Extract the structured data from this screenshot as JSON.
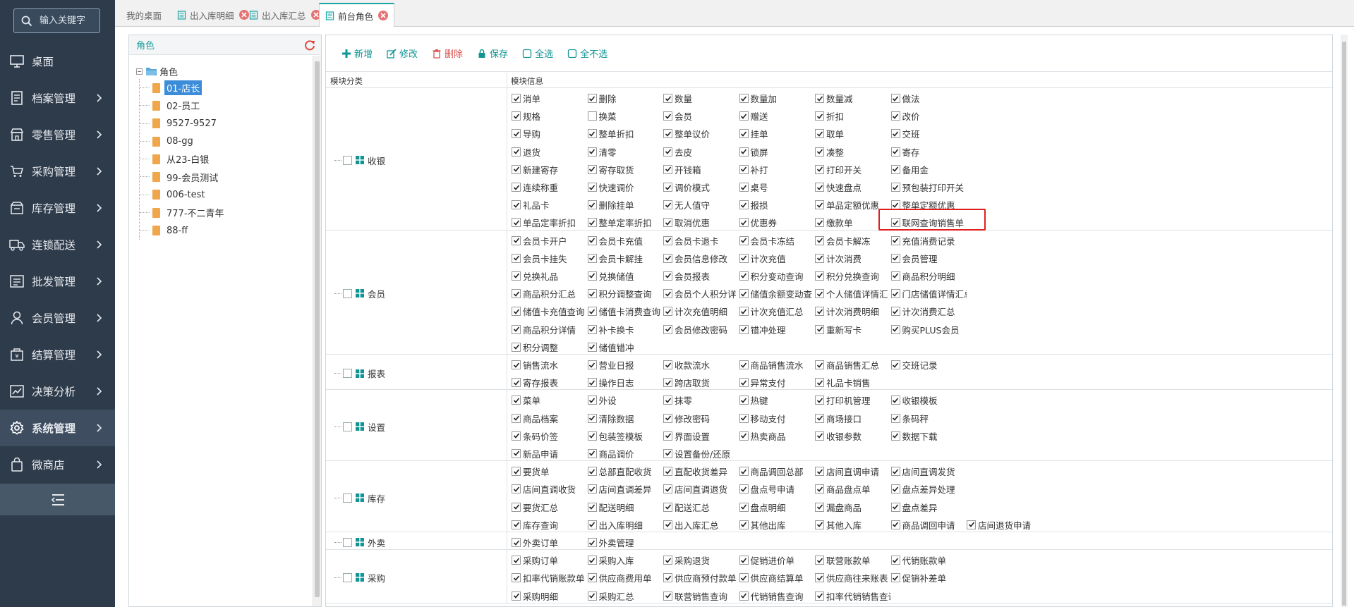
{
  "search": {
    "placeholder": "输入关键字"
  },
  "sidebar": {
    "items": [
      {
        "label": "桌面",
        "icon": "monitor-icon",
        "has_arrow": false
      },
      {
        "label": "档案管理",
        "icon": "archive-icon",
        "has_arrow": true
      },
      {
        "label": "零售管理",
        "icon": "store-icon",
        "has_arrow": true
      },
      {
        "label": "采购管理",
        "icon": "cart-icon",
        "has_arrow": true
      },
      {
        "label": "库存管理",
        "icon": "inventory-icon",
        "has_arrow": true
      },
      {
        "label": "连锁配送",
        "icon": "truck-icon",
        "has_arrow": true
      },
      {
        "label": "批发管理",
        "icon": "wholesale-icon",
        "has_arrow": true
      },
      {
        "label": "会员管理",
        "icon": "user-icon",
        "has_arrow": true
      },
      {
        "label": "结算管理",
        "icon": "settlement-icon",
        "has_arrow": true
      },
      {
        "label": "决策分析",
        "icon": "chart-icon",
        "has_arrow": true
      },
      {
        "label": "系统管理",
        "icon": "gear-icon",
        "has_arrow": true,
        "active": true
      },
      {
        "label": "微商店",
        "icon": "shop-bag-icon",
        "has_arrow": true
      }
    ]
  },
  "tabs": [
    {
      "label": "我的桌面",
      "closable": false,
      "active": false
    },
    {
      "label": "出入库明细",
      "closable": true,
      "active": false
    },
    {
      "label": "出入库汇总",
      "closable": true,
      "active": false
    },
    {
      "label": "前台角色",
      "closable": true,
      "active": true
    }
  ],
  "role_panel": {
    "title": "角色",
    "root": "角色",
    "roles": [
      "01-店长",
      "02-员工",
      "9527-9527",
      "08-gg",
      "从23-白银",
      "99-会员测试",
      "006-test",
      "777-不二青年",
      "88-ff"
    ],
    "selected": "01-店长"
  },
  "toolbar": {
    "add": "新增",
    "edit": "修改",
    "delete": "删除",
    "save": "保存",
    "select_all": "全选",
    "select_none": "全不选"
  },
  "table": {
    "col_category": "模块分类",
    "col_info": "模块信息"
  },
  "colors": {
    "accent": "#139494",
    "sidebar_bg": "#2e3b4a",
    "danger": "#d9534f",
    "highlight": "#e02020"
  },
  "groups": [
    {
      "name": "收银",
      "rows": [
        [
          {
            "t": "消单",
            "c": true
          },
          {
            "t": "删除",
            "c": true
          },
          {
            "t": "数量",
            "c": true
          },
          {
            "t": "数量加",
            "c": true
          },
          {
            "t": "数量减",
            "c": true
          },
          {
            "t": "做法",
            "c": true
          }
        ],
        [
          {
            "t": "规格",
            "c": true
          },
          {
            "t": "换菜",
            "c": false
          },
          {
            "t": "会员",
            "c": true
          },
          {
            "t": "赠送",
            "c": true
          },
          {
            "t": "折扣",
            "c": true
          },
          {
            "t": "改价",
            "c": true
          }
        ],
        [
          {
            "t": "导购",
            "c": true
          },
          {
            "t": "整单折扣",
            "c": true
          },
          {
            "t": "整单议价",
            "c": true
          },
          {
            "t": "挂单",
            "c": true
          },
          {
            "t": "取单",
            "c": true
          },
          {
            "t": "交班",
            "c": true
          }
        ],
        [
          {
            "t": "退货",
            "c": true
          },
          {
            "t": "清零",
            "c": true
          },
          {
            "t": "去皮",
            "c": true
          },
          {
            "t": "锁屏",
            "c": true
          },
          {
            "t": "凑整",
            "c": true
          },
          {
            "t": "寄存",
            "c": true
          }
        ],
        [
          {
            "t": "新建寄存",
            "c": true
          },
          {
            "t": "寄存取货",
            "c": true
          },
          {
            "t": "开钱箱",
            "c": true
          },
          {
            "t": "补打",
            "c": true
          },
          {
            "t": "打印开关",
            "c": true
          },
          {
            "t": "备用金",
            "c": true
          }
        ],
        [
          {
            "t": "连续称重",
            "c": true
          },
          {
            "t": "快速调价",
            "c": true
          },
          {
            "t": "调价模式",
            "c": true
          },
          {
            "t": "桌号",
            "c": true
          },
          {
            "t": "快速盘点",
            "c": true
          },
          {
            "t": "预包装打印开关",
            "c": true
          }
        ],
        [
          {
            "t": "礼品卡",
            "c": true
          },
          {
            "t": "删除挂单",
            "c": true
          },
          {
            "t": "无人值守",
            "c": true
          },
          {
            "t": "报损",
            "c": true
          },
          {
            "t": "单品定额优惠",
            "c": true
          },
          {
            "t": "整单定额优惠",
            "c": true
          }
        ],
        [
          {
            "t": "单品定率折扣",
            "c": true
          },
          {
            "t": "整单定率折扣",
            "c": true
          },
          {
            "t": "取消优惠",
            "c": true
          },
          {
            "t": "优惠券",
            "c": true
          },
          {
            "t": "缴款单",
            "c": true
          },
          {
            "t": "联网查询销售单",
            "c": true
          }
        ]
      ]
    },
    {
      "name": "会员",
      "rows": [
        [
          {
            "t": "会员卡开户",
            "c": true
          },
          {
            "t": "会员卡充值",
            "c": true
          },
          {
            "t": "会员卡退卡",
            "c": true
          },
          {
            "t": "会员卡冻结",
            "c": true
          },
          {
            "t": "会员卡解冻",
            "c": true
          },
          {
            "t": "充值消费记录",
            "c": true
          }
        ],
        [
          {
            "t": "会员卡挂失",
            "c": true
          },
          {
            "t": "会员卡解挂",
            "c": true
          },
          {
            "t": "会员信息修改",
            "c": true
          },
          {
            "t": "计次充值",
            "c": true
          },
          {
            "t": "计次消费",
            "c": true
          },
          {
            "t": "会员管理",
            "c": true
          }
        ],
        [
          {
            "t": "兑换礼品",
            "c": true
          },
          {
            "t": "兑换储值",
            "c": true
          },
          {
            "t": "会员报表",
            "c": true
          },
          {
            "t": "积分变动查询",
            "c": true
          },
          {
            "t": "积分兑换查询",
            "c": true
          },
          {
            "t": "商品积分明细",
            "c": true
          }
        ],
        [
          {
            "t": "商品积分汇总",
            "c": true
          },
          {
            "t": "积分调整查询",
            "c": true
          },
          {
            "t": "会员个人积分详",
            "c": true
          },
          {
            "t": "储值余额变动查",
            "c": true
          },
          {
            "t": "个人储值详情汇",
            "c": true
          },
          {
            "t": "门店储值详情汇总",
            "c": true
          }
        ],
        [
          {
            "t": "储值卡充值查询",
            "c": true
          },
          {
            "t": "储值卡消费查询",
            "c": true
          },
          {
            "t": "计次充值明细",
            "c": true
          },
          {
            "t": "计次充值汇总",
            "c": true
          },
          {
            "t": "计次消费明细",
            "c": true
          },
          {
            "t": "计次消费汇总",
            "c": true
          }
        ],
        [
          {
            "t": "商品积分详情",
            "c": true
          },
          {
            "t": "补卡换卡",
            "c": true
          },
          {
            "t": "会员修改密码",
            "c": true
          },
          {
            "t": "错冲处理",
            "c": true
          },
          {
            "t": "重新写卡",
            "c": true
          },
          {
            "t": "购买PLUS会员",
            "c": true
          }
        ],
        [
          {
            "t": "积分调整",
            "c": true
          },
          {
            "t": "储值错冲",
            "c": true
          }
        ]
      ]
    },
    {
      "name": "报表",
      "rows": [
        [
          {
            "t": "销售流水",
            "c": true
          },
          {
            "t": "营业日报",
            "c": true
          },
          {
            "t": "收款流水",
            "c": true
          },
          {
            "t": "商品销售流水",
            "c": true
          },
          {
            "t": "商品销售汇总",
            "c": true
          },
          {
            "t": "交班记录",
            "c": true
          }
        ],
        [
          {
            "t": "寄存报表",
            "c": true
          },
          {
            "t": "操作日志",
            "c": true
          },
          {
            "t": "跨店取货",
            "c": true
          },
          {
            "t": "异常支付",
            "c": true
          },
          {
            "t": "礼品卡销售",
            "c": true
          }
        ]
      ]
    },
    {
      "name": "设置",
      "rows": [
        [
          {
            "t": "菜单",
            "c": true
          },
          {
            "t": "外设",
            "c": true
          },
          {
            "t": "抹零",
            "c": true
          },
          {
            "t": "热键",
            "c": true
          },
          {
            "t": "打印机管理",
            "c": true
          },
          {
            "t": "收银模板",
            "c": true
          }
        ],
        [
          {
            "t": "商品档案",
            "c": true
          },
          {
            "t": "清除数据",
            "c": true
          },
          {
            "t": "修改密码",
            "c": true
          },
          {
            "t": "移动支付",
            "c": true
          },
          {
            "t": "商场接口",
            "c": true
          },
          {
            "t": "条码秤",
            "c": true
          }
        ],
        [
          {
            "t": "条码价签",
            "c": true
          },
          {
            "t": "包装签模板",
            "c": true
          },
          {
            "t": "界面设置",
            "c": true
          },
          {
            "t": "热卖商品",
            "c": true
          },
          {
            "t": "收银参数",
            "c": true
          },
          {
            "t": "数据下载",
            "c": true
          }
        ],
        [
          {
            "t": "新品申请",
            "c": true
          },
          {
            "t": "商品调价",
            "c": true
          },
          {
            "t": "设置备份/还原",
            "c": true
          }
        ]
      ]
    },
    {
      "name": "库存",
      "rows": [
        [
          {
            "t": "要货单",
            "c": true
          },
          {
            "t": "总部直配收货",
            "c": true
          },
          {
            "t": "直配收货差异",
            "c": true
          },
          {
            "t": "商品调回总部",
            "c": true
          },
          {
            "t": "店间直调申请",
            "c": true
          },
          {
            "t": "店间直调发货",
            "c": true
          }
        ],
        [
          {
            "t": "店间直调收货",
            "c": true
          },
          {
            "t": "店间直调差异",
            "c": true
          },
          {
            "t": "店间直调退货",
            "c": true
          },
          {
            "t": "盘点号申请",
            "c": true
          },
          {
            "t": "商品盘点单",
            "c": true
          },
          {
            "t": "盘点差异处理",
            "c": true
          }
        ],
        [
          {
            "t": "要货汇总",
            "c": true
          },
          {
            "t": "配送明细",
            "c": true
          },
          {
            "t": "配送汇总",
            "c": true
          },
          {
            "t": "盘点明细",
            "c": true
          },
          {
            "t": "漏盘商品",
            "c": true
          },
          {
            "t": "盘点差异",
            "c": true
          }
        ],
        [
          {
            "t": "库存查询",
            "c": true
          },
          {
            "t": "出入库明细",
            "c": true
          },
          {
            "t": "出入库汇总",
            "c": true
          },
          {
            "t": "其他出库",
            "c": true
          },
          {
            "t": "其他入库",
            "c": true
          },
          {
            "t": "商品调回申请",
            "c": true
          },
          {
            "t": "店间退货申请",
            "c": true
          }
        ]
      ]
    },
    {
      "name": "外卖",
      "rows": [
        [
          {
            "t": "外卖订单",
            "c": true
          },
          {
            "t": "外卖管理",
            "c": true
          }
        ]
      ]
    },
    {
      "name": "采购",
      "rows": [
        [
          {
            "t": "采购订单",
            "c": true
          },
          {
            "t": "采购入库",
            "c": true
          },
          {
            "t": "采购退货",
            "c": true
          },
          {
            "t": "促销进价单",
            "c": true
          },
          {
            "t": "联营账款单",
            "c": true
          },
          {
            "t": "代销账款单",
            "c": true
          }
        ],
        [
          {
            "t": "扣率代销账款单",
            "c": true
          },
          {
            "t": "供应商费用单",
            "c": true
          },
          {
            "t": "供应商预付款单",
            "c": true
          },
          {
            "t": "供应商结算单",
            "c": true
          },
          {
            "t": "供应商往来账表",
            "c": true
          },
          {
            "t": "促销补差单",
            "c": true
          }
        ],
        [
          {
            "t": "采购明细",
            "c": true
          },
          {
            "t": "采购汇总",
            "c": true
          },
          {
            "t": "联营销售查询",
            "c": true
          },
          {
            "t": "代销销售查询",
            "c": true
          },
          {
            "t": "扣率代销销售查询",
            "c": true
          }
        ]
      ]
    }
  ]
}
